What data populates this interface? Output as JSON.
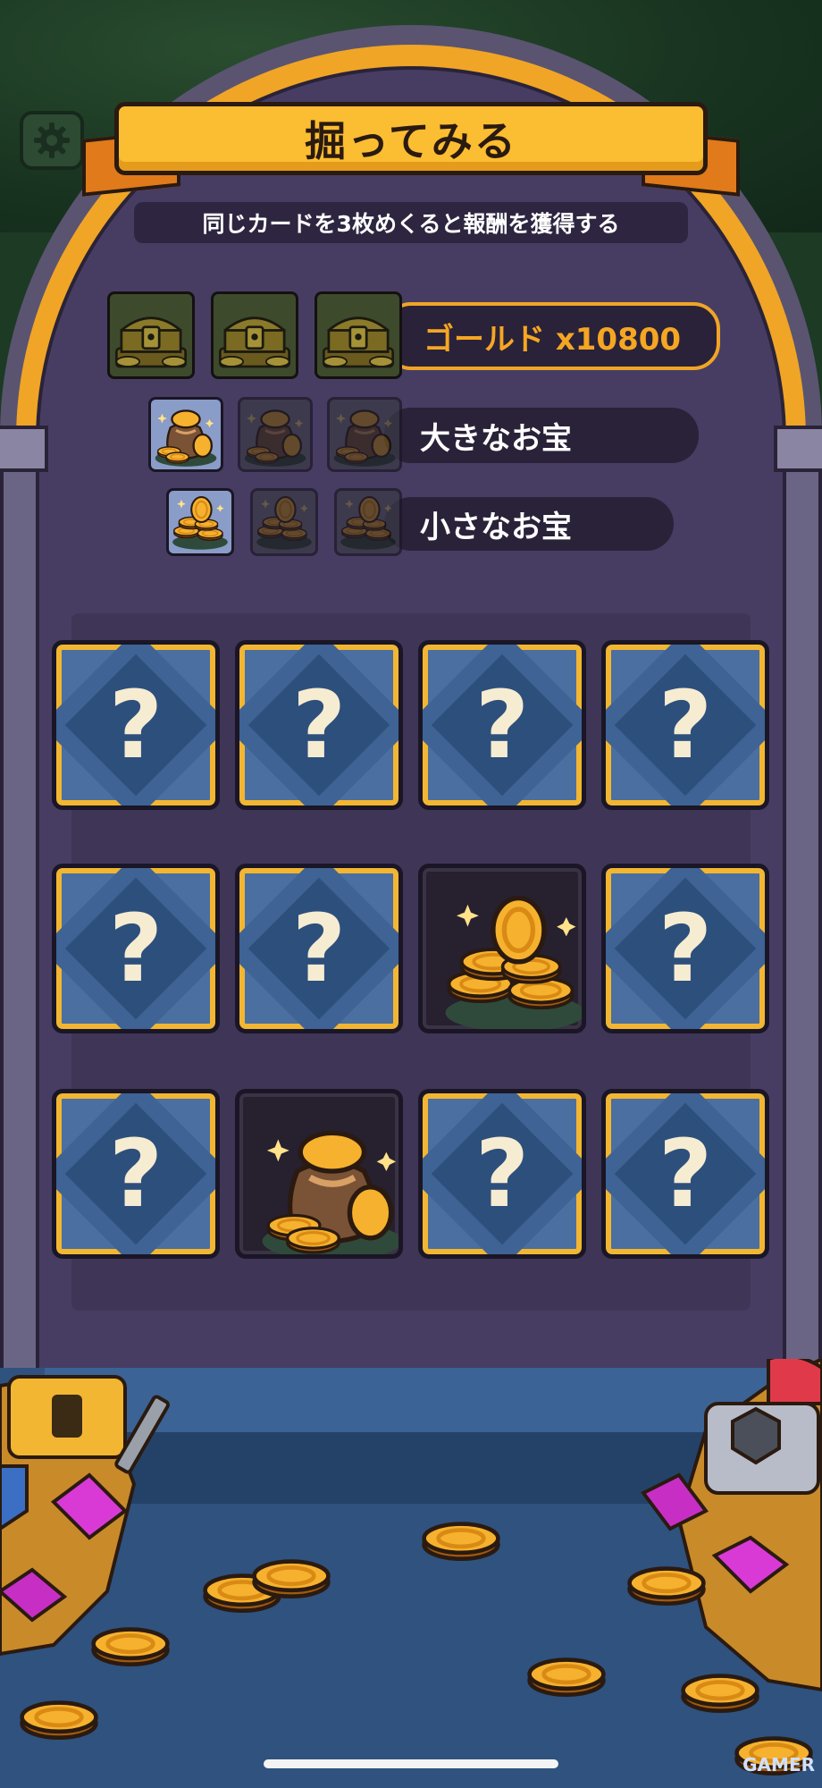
{
  "header": {
    "title": "掘ってみる",
    "subtitle": "同じカードを3枚めくると報酬を獲得する"
  },
  "rewards": [
    {
      "label": "ゴールド x10800",
      "icon": "treasure-chest-icon",
      "matched": 0
    },
    {
      "label": "大きなお宝",
      "icon": "coin-bag-icon",
      "matched": 1
    },
    {
      "label": "小さなお宝",
      "icon": "coin-pile-icon",
      "matched": 1
    }
  ],
  "cards": [
    {
      "state": "hidden",
      "symbol": "?"
    },
    {
      "state": "hidden",
      "symbol": "?"
    },
    {
      "state": "hidden",
      "symbol": "?"
    },
    {
      "state": "hidden",
      "symbol": "?"
    },
    {
      "state": "hidden",
      "symbol": "?"
    },
    {
      "state": "hidden",
      "symbol": "?"
    },
    {
      "state": "revealed",
      "icon": "coin-pile-icon"
    },
    {
      "state": "hidden",
      "symbol": "?"
    },
    {
      "state": "hidden",
      "symbol": "?"
    },
    {
      "state": "revealed",
      "icon": "coin-bag-icon"
    },
    {
      "state": "hidden",
      "symbol": "?"
    },
    {
      "state": "hidden",
      "symbol": "?"
    }
  ],
  "watermark": "GAMER",
  "colors": {
    "gold": "#f0a526",
    "card_blue": "#4a6fa0",
    "arch_purple": "#473d63"
  }
}
